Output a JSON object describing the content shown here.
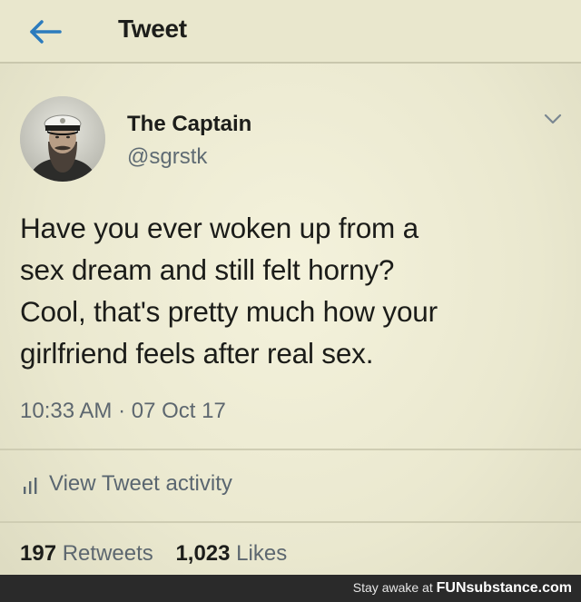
{
  "header": {
    "title": "Tweet"
  },
  "tweet": {
    "author_name": "The Captain",
    "author_handle": "@sgrstk",
    "text_lines": [
      "Have you ever woken up from a",
      "sex dream and still felt horny?",
      "Cool, that's pretty much how your",
      "girlfriend feels after real sex."
    ],
    "timestamp": "10:33 AM · 07 Oct 17"
  },
  "activity": {
    "label": "View Tweet activity"
  },
  "stats": {
    "retweets_count": "197",
    "retweets_label": "Retweets",
    "likes_count": "1,023",
    "likes_label": "Likes"
  },
  "footer": {
    "prefix": "Stay awake at",
    "brand": "FUNsubstance.com"
  },
  "icons": {
    "back": "back-arrow-icon",
    "menu": "chevron-down-icon",
    "activity": "bar-chart-icon",
    "avatar": "avatar"
  },
  "colors": {
    "background": "#ecebd2",
    "accent_blue": "#2b7bbd",
    "muted_text": "#5d676f"
  }
}
